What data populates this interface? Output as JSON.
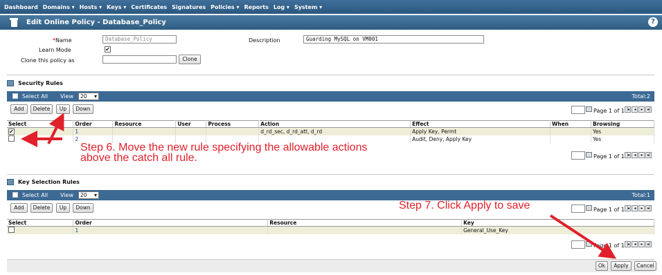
{
  "nav": [
    "Dashboard",
    "Domains ▾",
    "Hosts ▾",
    "Keys ▾",
    "Certificates",
    "Signatures",
    "Policies ▾",
    "Reports",
    "Log ▾",
    "System ▾"
  ],
  "title": "Edit Online Policy - Database_Policy",
  "help_label": "?",
  "form": {
    "name_label": "*Name",
    "name_value": "Database_Policy",
    "description_label": "Description",
    "description_value": "Guarding MySQL on VM001",
    "learn_mode_label": "Learn Mode",
    "learn_mode_checked": true,
    "clone_label": "Clone this policy as",
    "clone_value": "",
    "clone_button": "Clone"
  },
  "security_rules": {
    "heading": "Security Rules",
    "select_all": "Select All",
    "view_label": "View",
    "view_value": "20",
    "total": "Total:2",
    "buttons": [
      "Add",
      "Delete",
      "Up",
      "Down"
    ],
    "page_text": "Page 1 of 1",
    "columns": [
      "Select",
      "Order",
      "Resource",
      "User",
      "Process",
      "Action",
      "Effect",
      "When",
      "Browsing"
    ],
    "rows": [
      {
        "checked": true,
        "order": "1",
        "resource": "",
        "user": "",
        "process": "",
        "action": "d_rd_sec, d_rd_att, d_rd",
        "effect": "Apply Key, Permt",
        "when": "",
        "browsing": "Yes"
      },
      {
        "checked": false,
        "order": "2",
        "resource": "",
        "user": "",
        "process": "",
        "action": "",
        "effect": "Audit, Deny, Apply Key",
        "when": "",
        "browsing": "Yes"
      }
    ]
  },
  "key_rules": {
    "heading": "Key Selection Rules",
    "select_all": "Select All",
    "view_label": "View",
    "view_value": "20",
    "total": "Total:1",
    "buttons": [
      "Add",
      "Delete",
      "Up",
      "Down"
    ],
    "page_text": "Page 1 of 1",
    "columns": [
      "Select",
      "Order",
      "Resource",
      "Key"
    ],
    "rows": [
      {
        "checked": false,
        "order": "1",
        "resource": "",
        "key": "General_Use_Key"
      }
    ]
  },
  "footer_buttons": [
    "Ok",
    "Apply",
    "Cancel"
  ],
  "annotations": {
    "step6_line1": "Step 6. Move the new rule specifying the allowable actions",
    "step6_line2": "above the catch all rule.",
    "step7": "Step 7. Click Apply to save"
  },
  "colors": {
    "annotation": "#e0202a",
    "header": "#3c6a94",
    "highlight_row": "#eeeed8"
  }
}
